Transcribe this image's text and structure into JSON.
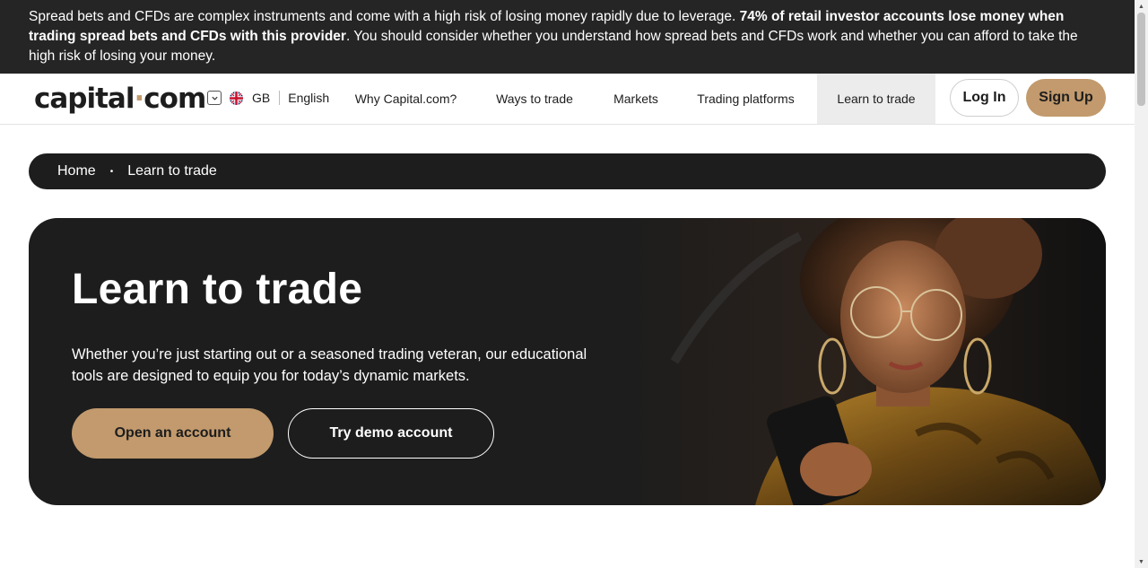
{
  "risk_banner": {
    "text_start": "Spread bets and CFDs are complex instruments and come with a high risk of losing money rapidly due to leverage. ",
    "text_bold": "74% of retail investor accounts lose money when trading spread bets and CFDs with this provider",
    "text_end": ". You should consider whether you understand how spread bets and CFDs work and whether you can afford to take the high risk of losing your money."
  },
  "header": {
    "logo_left": "capital",
    "logo_dot": "·",
    "logo_right": "com",
    "region_code": "GB",
    "language": "English",
    "nav": [
      "Why Capital.com?",
      "Ways to trade",
      "Markets",
      "Trading platforms",
      "Learn to trade"
    ],
    "active_nav": "Learn to trade",
    "login_label": "Log In",
    "signup_label": "Sign Up"
  },
  "breadcrumb": {
    "items": [
      "Home",
      "Learn to trade"
    ],
    "separator": "•"
  },
  "hero": {
    "title": "Learn to trade",
    "description": "Whether you’re just starting out or a seasoned trading veteran, our educational tools are designed to equip you for today’s dynamic markets.",
    "primary_button": "Open an account",
    "secondary_button": "Try demo account"
  },
  "colors": {
    "brand_accent": "#c29a6d",
    "dark": "#1d1d1d",
    "banner": "#252525"
  },
  "icons": {
    "region_toggle": "chevron-down-icon",
    "flag": "uk-flag-icon"
  }
}
